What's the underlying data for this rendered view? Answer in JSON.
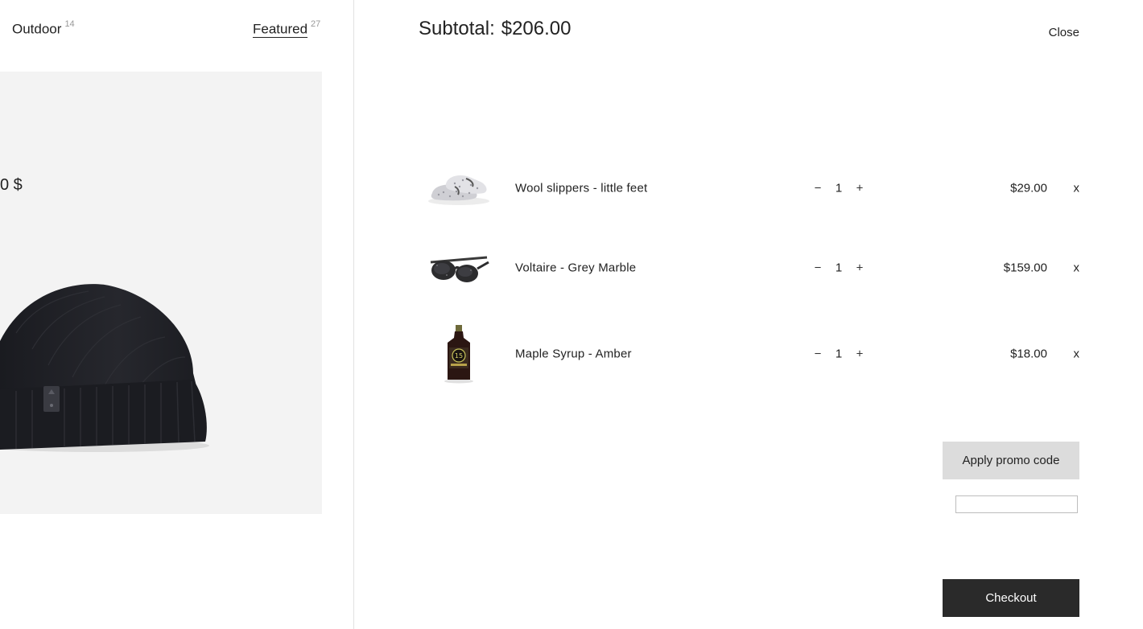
{
  "background_page": {
    "filters": [
      {
        "label": "Outdoor",
        "count": "14"
      },
      {
        "label": "Featured",
        "count": "27"
      }
    ],
    "card_price": "0 $"
  },
  "cart": {
    "subtotal_label": "Subtotal:",
    "subtotal_value": "$206.00",
    "close_label": "Close",
    "items": [
      {
        "name": "Wool slippers - little feet",
        "qty": "1",
        "price": "$29.00",
        "minus": "−",
        "plus": "+",
        "remove": "x",
        "icon": "slippers-image"
      },
      {
        "name": "Voltaire - Grey Marble",
        "qty": "1",
        "price": "$159.00",
        "minus": "−",
        "plus": "+",
        "remove": "x",
        "icon": "sunglasses-image"
      },
      {
        "name": "Maple Syrup - Amber",
        "qty": "1",
        "price": "$18.00",
        "minus": "−",
        "plus": "+",
        "remove": "x",
        "icon": "syrup-bottle-image"
      }
    ],
    "promo_button_label": "Apply promo code",
    "promo_input_value": "",
    "checkout_label": "Checkout"
  },
  "colors": {
    "card_bg": "#f3f3f3",
    "promo_bg": "#dcdcdc",
    "checkout_bg": "#2a2a2a"
  }
}
